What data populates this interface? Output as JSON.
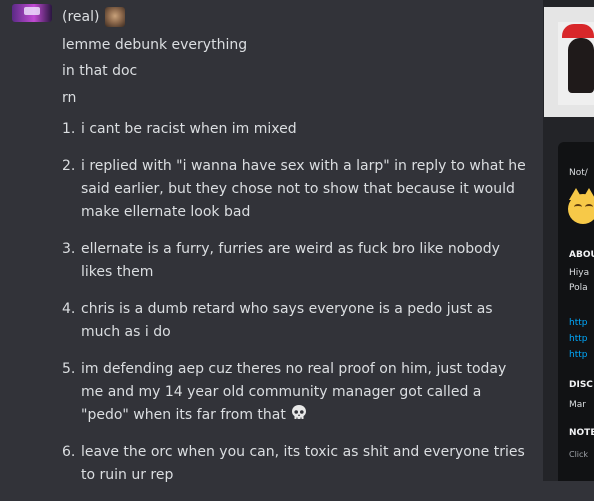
{
  "message": {
    "header": "(real)",
    "lines": [
      "lemme debunk everything",
      "in that doc",
      "rn"
    ],
    "items": [
      {
        "n": "1.",
        "text": "i cant be racist when im mixed"
      },
      {
        "n": "2.",
        "text": "i replied with \"i wanna have sex with a larp\" in reply to what he said earlier, but they chose not to show that because it would make ellernate look bad"
      },
      {
        "n": "3.",
        "text": "ellernate is a furry, furries are weird as fuck bro like nobody likes them"
      },
      {
        "n": "4.",
        "text": "chris is a dumb retard who says everyone is a pedo just as much as i do"
      },
      {
        "n": "5.",
        "text": "im defending aep cuz theres no real proof on him, just today me and my 14 year old community manager got called a \"pedo\" when its far from that"
      },
      {
        "n": "6.",
        "text": "leave the orc when you can, its toxic as shit and everyone tries to ruin ur rep"
      }
    ]
  },
  "profile": {
    "status": "Not/",
    "about_heading": "ABOU",
    "about_1": "Hiya",
    "about_2": "Pola",
    "link_1": "http",
    "link_2": "http",
    "link_3": "http",
    "member_heading": "DISC",
    "member_since": "Mar",
    "note_heading": "NOTE",
    "note_placeholder": "Click"
  }
}
